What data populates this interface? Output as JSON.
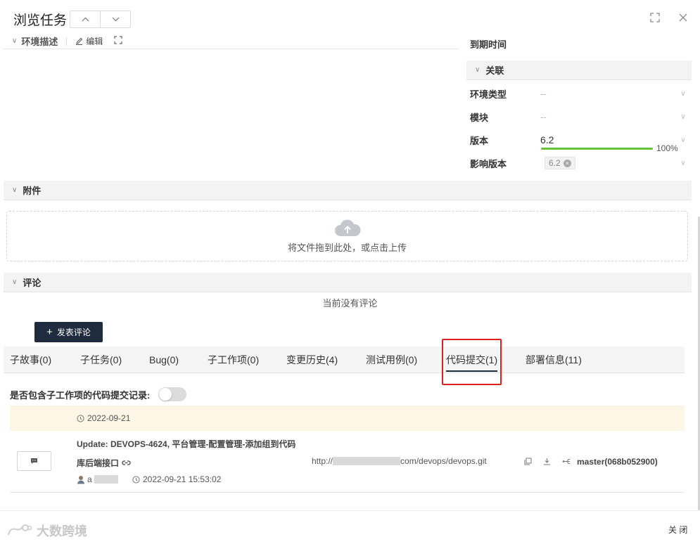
{
  "header": {
    "title": "浏览任务",
    "prev_glyph": "︿",
    "next_glyph": "﹀"
  },
  "env": {
    "label": "环境描述",
    "edit_label": "编辑"
  },
  "right_panel": {
    "due_label": "到期时间",
    "related_section": "关联",
    "fields": {
      "env_type": {
        "label": "环境类型",
        "value": "--"
      },
      "module": {
        "label": "模块",
        "value": "--"
      },
      "version": {
        "label": "版本",
        "value": "6.2",
        "progress_percent": 100,
        "progress_text": "100%"
      },
      "affected_version": {
        "label": "影响版本",
        "tag": "6.2"
      }
    }
  },
  "attachments": {
    "section": "附件",
    "upload_text": "将文件拖到此处，或点击上传"
  },
  "comments": {
    "section": "评论",
    "empty_text": "当前没有评论",
    "post_button": "发表评论"
  },
  "tabs": [
    {
      "label": "子故事(0)"
    },
    {
      "label": "子任务(0)"
    },
    {
      "label": "Bug(0)"
    },
    {
      "label": "子工作项(0)"
    },
    {
      "label": "变更历史(4)"
    },
    {
      "label": "测试用例(0)"
    },
    {
      "label": "代码提交(1)",
      "active": true
    },
    {
      "label": "部署信息(11)"
    }
  ],
  "code_commits": {
    "toggle_label": "是否包含子工作项的代码提交记录:",
    "toggle_on": false,
    "date": "2022-09-21",
    "commit": {
      "message": "Update: DEVOPS-4624, 平台管理-配置管理-添加组到代码",
      "repo": "库后端接口",
      "url_prefix": "http://",
      "url_suffix": "com/devops/devops.git",
      "author_initial": "a",
      "time": "2022-09-21 15:53:02",
      "branch": "master(068b052900)"
    }
  },
  "footer": {
    "watermark": "大数跨境",
    "close_label": "关 闭"
  },
  "colors": {
    "primary_dark": "#1f2b3e",
    "progress_green": "#67c23a",
    "highlight_red": "#e02020",
    "date_bar_bg": "#fdf5e5"
  }
}
